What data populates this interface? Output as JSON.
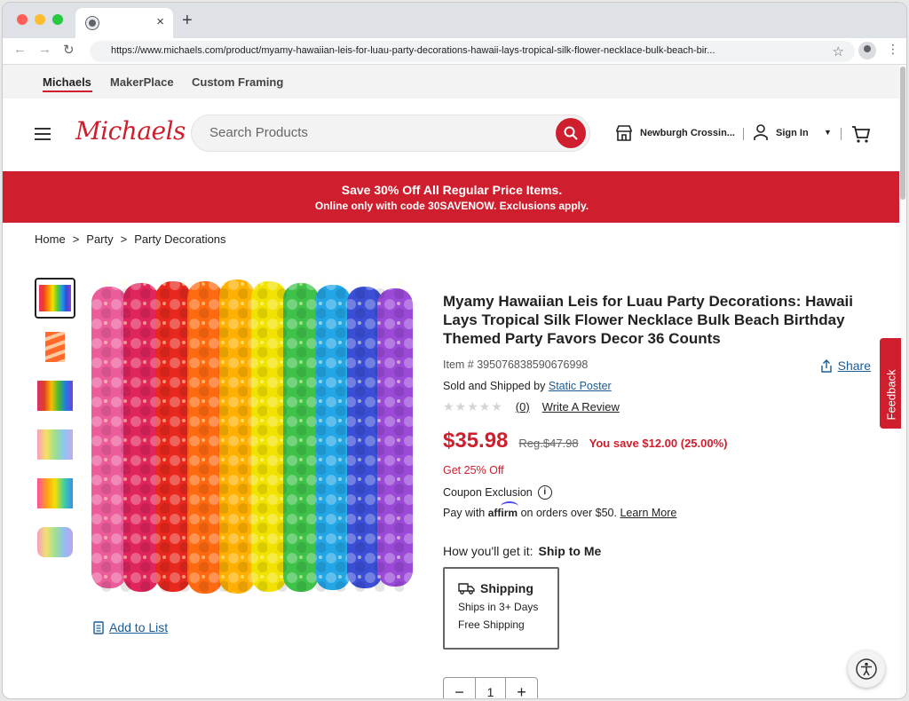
{
  "browser": {
    "url": "https://www.michaels.com/product/myamy-hawaiian-leis-for-luau-party-decorations-hawaii-lays-tropical-silk-flower-necklace-bulk-beach-bir...",
    "tab_close": "×",
    "new_tab": "+"
  },
  "sitenav": {
    "items": [
      "Michaels",
      "MakerPlace",
      "Custom Framing"
    ]
  },
  "header": {
    "logo": "Michaels",
    "search_placeholder": "Search Products",
    "store": "Newburgh Crossin...",
    "signin": "Sign In"
  },
  "promo": {
    "line1": "Save 30% Off All Regular Price Items.",
    "line2": "Online only with code 30SAVENOW. Exclusions apply."
  },
  "breadcrumb": [
    "Home",
    ">",
    "Party",
    ">",
    "Party Decorations"
  ],
  "product": {
    "title": "Myamy Hawaiian Leis for Luau Party Decorations: Hawaii Lays Tropical Silk Flower Necklace Bulk Beach Birthday Themed Party Favors Decor 36 Counts",
    "item": "Item # 395076838590676998",
    "share": "Share",
    "sold_prefix": "Sold and Shipped by",
    "seller": "Static Poster",
    "review_count": "(0)",
    "write_review": "Write A Review",
    "price": "$35.98",
    "reg_price": "Reg.$47.98",
    "savings": "You save $12.00 (25.00%)",
    "discount_note": "Get 25% Off",
    "coupon": "Coupon Exclusion",
    "affirm_prefix": "Pay with",
    "affirm_brand": "affirm",
    "affirm_suffix": "on orders over $50.",
    "learn_more": "Learn More",
    "how_label": "How you'll get it:",
    "how_value": "Ship to Me",
    "ship_title": "Shipping",
    "ship_line1": "Ships in 3+ Days",
    "ship_line2": "Free Shipping",
    "qty": "1",
    "add_to_list": "Add to List",
    "rating": 0
  },
  "feedback": "Feedback",
  "colors": {
    "brand_red": "#cf1f2e",
    "link_blue": "#1a5c96"
  }
}
